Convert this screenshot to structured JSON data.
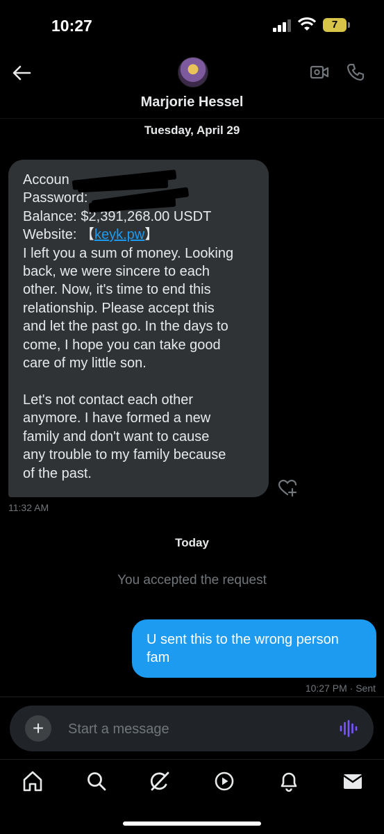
{
  "status_bar": {
    "time": "10:27",
    "battery": "7"
  },
  "header": {
    "contact_name": "Marjorie Hessel"
  },
  "conversation": {
    "date_1": "Tuesday, April 29",
    "incoming": {
      "line1": "Accoun",
      "line2": "Password:",
      "line3": "Balance: $2,391,268.00 USDT",
      "website_label": "Website: 【",
      "website_link": "keyk.pw",
      "website_end": "】",
      "body_lines": [
        "I left you a sum of money. Looking",
        "back, we were sincere to each",
        "other. Now, it's time to end this",
        "relationship. Please accept this",
        "and let the past go. In the days to",
        "come, I hope you can take good",
        "care of my little son."
      ],
      "body2_lines": [
        "Let's not contact each other",
        "anymore. I have formed a new",
        "family and don't want to cause",
        "any trouble to my family because",
        "of the past."
      ],
      "time": "11:32 AM"
    },
    "date_2": "Today",
    "system_message": "You accepted the request",
    "outgoing": {
      "line1": "U sent this to the wrong person",
      "line2": "fam",
      "status": "10:27 PM · Sent"
    }
  },
  "composer": {
    "placeholder": "Start a message"
  },
  "colors": {
    "accent": "#1d9bf0",
    "voice": "#7856ff",
    "bubble_in": "#2f3336"
  },
  "icons": [
    "back-arrow-icon",
    "video-icon",
    "phone-icon",
    "heart-plus-icon",
    "plus-icon",
    "voice-wave-icon",
    "home-icon",
    "search-icon",
    "grok-icon",
    "play-icon",
    "bell-icon",
    "mail-icon"
  ]
}
